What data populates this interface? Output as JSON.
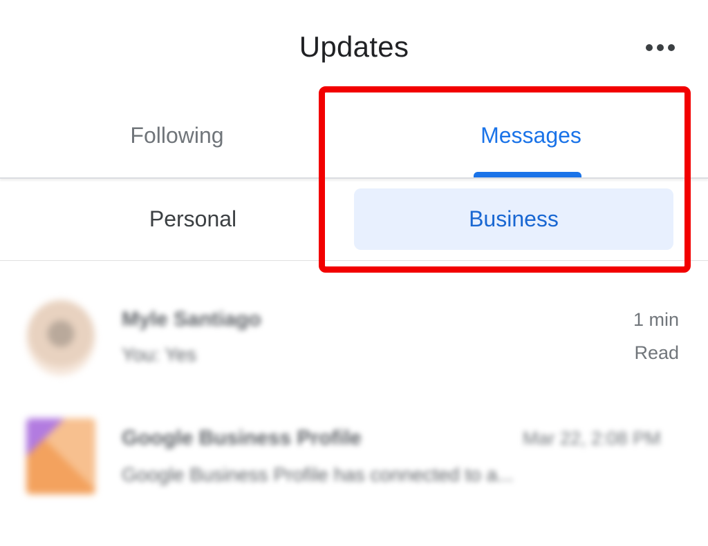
{
  "header": {
    "title": "Updates",
    "more_icon": "more-horizontal-icon"
  },
  "tabs": [
    {
      "label": "Following",
      "selected": false
    },
    {
      "label": "Messages",
      "selected": true
    }
  ],
  "subtabs": [
    {
      "label": "Personal",
      "selected": false
    },
    {
      "label": "Business",
      "selected": true
    }
  ],
  "colors": {
    "accent": "#1a73e8",
    "chip_bg": "#e8f0fe",
    "highlight": "#f20000"
  },
  "conversations": [
    {
      "name": "Myle Santiago",
      "preview": "You: Yes",
      "time": "1 min",
      "status": "Read",
      "blurred": true
    },
    {
      "name": "Google Business Profile",
      "preview": "Google Business Profile has connected to a...",
      "date": "Mar 22, 2:08 PM",
      "blurred": true
    }
  ]
}
